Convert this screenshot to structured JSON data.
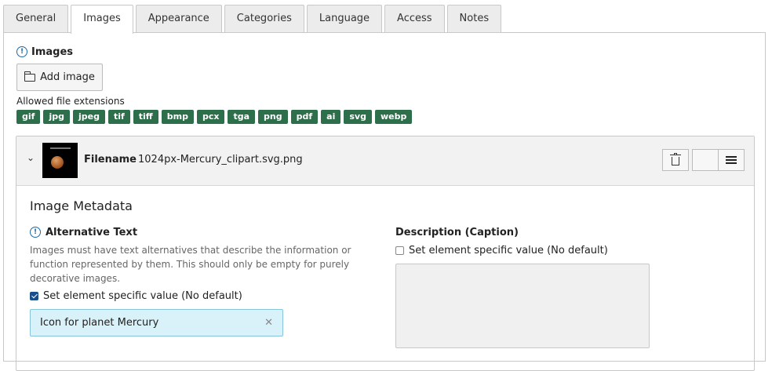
{
  "tabs": [
    {
      "label": "General",
      "active": false
    },
    {
      "label": "Images",
      "active": true
    },
    {
      "label": "Appearance",
      "active": false
    },
    {
      "label": "Categories",
      "active": false
    },
    {
      "label": "Language",
      "active": false
    },
    {
      "label": "Access",
      "active": false
    },
    {
      "label": "Notes",
      "active": false
    }
  ],
  "images_field": {
    "title": "Images",
    "add_button": "Add image",
    "allowed_label": "Allowed file extensions",
    "extensions": [
      "gif",
      "jpg",
      "jpeg",
      "tif",
      "tiff",
      "bmp",
      "pcx",
      "tga",
      "png",
      "pdf",
      "ai",
      "svg",
      "webp"
    ]
  },
  "file": {
    "filename_label": "Filename",
    "filename": "1024px-Mercury_clipart.svg.png",
    "metadata_title": "Image Metadata",
    "alt": {
      "title": "Alternative Text",
      "description": "Images must have text alternatives that describe the information or function represented by them. This should only be empty for purely decorative images.",
      "checkbox_label": "Set element specific value (No default)",
      "checked": true,
      "value": "Icon for planet Mercury"
    },
    "caption": {
      "title": "Description (Caption)",
      "checkbox_label": "Set element specific value (No default)",
      "checked": false
    }
  },
  "colors": {
    "extension_badge": "#2d6e4b",
    "alt_input_bg": "#d9f1f8",
    "checkbox_checked": "#1a4f8b",
    "info_icon": "#1a6aa8"
  }
}
